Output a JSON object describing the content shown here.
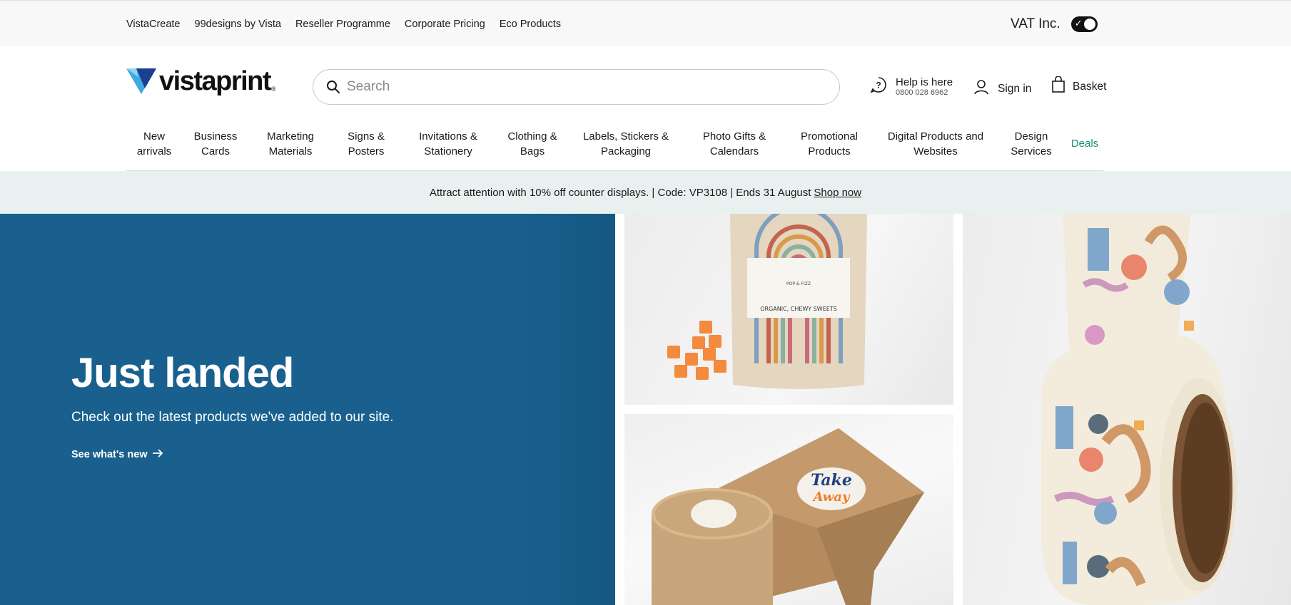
{
  "utility": {
    "links": [
      "VistaCreate",
      "99designs by Vista",
      "Reseller Programme",
      "Corporate Pricing",
      "Eco Products"
    ],
    "vat_label": "VAT Inc.",
    "vat_enabled": true
  },
  "header": {
    "logo_text": "vistaprint",
    "logo_mark": "®",
    "search_placeholder": "Search",
    "help_title": "Help is here",
    "help_phone": "0800 028 6962",
    "signin_label": "Sign in",
    "basket_label": "Basket",
    "icons": {
      "search": "search-icon",
      "help": "help-icon",
      "account": "user-icon",
      "basket": "shopping-bag-icon"
    }
  },
  "nav": {
    "items": [
      {
        "line1": "New",
        "line2": "arrivals"
      },
      {
        "line1": "Business",
        "line2": "Cards"
      },
      {
        "line1": "Marketing",
        "line2": "Materials"
      },
      {
        "line1": "Signs &",
        "line2": "Posters"
      },
      {
        "line1": "Invitations &",
        "line2": "Stationery"
      },
      {
        "line1": "Clothing &",
        "line2": "Bags"
      },
      {
        "line1": "Labels, Stickers &",
        "line2": "Packaging"
      },
      {
        "line1": "Photo Gifts &",
        "line2": "Calendars"
      },
      {
        "line1": "Promotional",
        "line2": "Products"
      },
      {
        "line1": "Digital Products and",
        "line2": "Websites"
      },
      {
        "line1": "Design",
        "line2": "Services"
      }
    ],
    "deals_label": "Deals"
  },
  "promo": {
    "text": "Attract attention with 10% off counter displays. | Code: VP3108 | Ends 31 August",
    "link": "Shop now"
  },
  "hero": {
    "title": "Just landed",
    "subtitle": "Check out the latest products we've added to our site.",
    "cta": "See what's new",
    "pouch_label_brand": "POP & FIZZ",
    "pouch_label_product": "ORGANIC, CHEWY SWEETS",
    "sticker_text_1": "Take",
    "sticker_text_2": "Away"
  },
  "colors": {
    "hero_blue": "#19608e",
    "promo_bg": "#e8f1ef",
    "deals_green": "#1c8f7a",
    "utility_bg": "#f8f8f8",
    "logo_cyan": "#3fa9e0",
    "logo_navy": "#1d3f8f"
  }
}
